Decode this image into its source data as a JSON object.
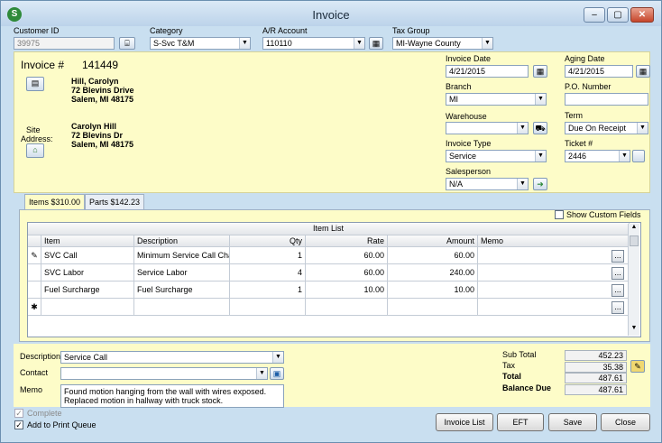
{
  "window": {
    "title": "Invoice",
    "app_icon": "S"
  },
  "header": {
    "customer_id_label": "Customer ID",
    "customer_id": "39975",
    "category_label": "Category",
    "category": "S-Svc T&M",
    "ar_label": "A/R Account",
    "ar": "110110",
    "taxgroup_label": "Tax Group",
    "taxgroup": "MI-Wayne County"
  },
  "invoice": {
    "label": "Invoice #",
    "number": "141449",
    "bill_name": "Hill, Carolyn",
    "bill_street": "72 Blevins Drive",
    "bill_city": "Salem, MI  48175",
    "site_label1": "Site",
    "site_label2": "Address:",
    "site_name": "Carolyn Hill",
    "site_street": "72 Blevins Dr",
    "site_city": "Salem, MI  48175"
  },
  "fields": {
    "invoice_date_label": "Invoice Date",
    "invoice_date": "4/21/2015",
    "aging_date_label": "Aging Date",
    "aging_date": "4/21/2015",
    "branch_label": "Branch",
    "branch": "MI",
    "po_label": "P.O. Number",
    "po": "",
    "warehouse_label": "Warehouse",
    "warehouse": "",
    "term_label": "Term",
    "term": "Due On Receipt",
    "invoice_type_label": "Invoice Type",
    "invoice_type": "Service",
    "ticket_label": "Ticket #",
    "ticket": "2446",
    "salesperson_label": "Salesperson",
    "salesperson": "N/A"
  },
  "tabs": [
    {
      "label": "Items",
      "amount": "$310.00"
    },
    {
      "label": "Parts",
      "amount": "$142.23"
    }
  ],
  "show_custom_fields": "Show Custom Fields",
  "grid": {
    "title": "Item List",
    "columns": [
      "Item",
      "Description",
      "Qty",
      "Rate",
      "Amount",
      "Memo"
    ],
    "rows": [
      {
        "item": "SVC Call",
        "description": "Minimum Service Call Charg",
        "qty": "1",
        "rate": "60.00",
        "amount": "60.00",
        "memo": ""
      },
      {
        "item": "SVC Labor",
        "description": "Service Labor",
        "qty": "4",
        "rate": "60.00",
        "amount": "240.00",
        "memo": ""
      },
      {
        "item": "Fuel Surcharge",
        "description": "Fuel Surcharge",
        "qty": "1",
        "rate": "10.00",
        "amount": "10.00",
        "memo": ""
      }
    ],
    "ellipsis": "...",
    "edit_marker": "✎",
    "new_marker": "✱"
  },
  "footer": {
    "description_label": "Description",
    "description": "Service Call",
    "contact_label": "Contact",
    "contact": "",
    "memo_label": "Memo",
    "memo_line1": "Found motion hanging from the wall with wires exposed.",
    "memo_line2": "Replaced  motion in hallway with truck stock.",
    "subtotal_label": "Sub Total",
    "subtotal": "452.23",
    "tax_label": "Tax",
    "tax": "35.38",
    "total_label": "Total",
    "total": "487.61",
    "balance_label": "Balance Due",
    "balance": "487.61",
    "complete_label": "Complete",
    "print_queue_label": "Add to Print Queue"
  },
  "buttons": {
    "invoice_list": "Invoice List",
    "eft": "EFT",
    "save": "Save",
    "close": "Close"
  }
}
